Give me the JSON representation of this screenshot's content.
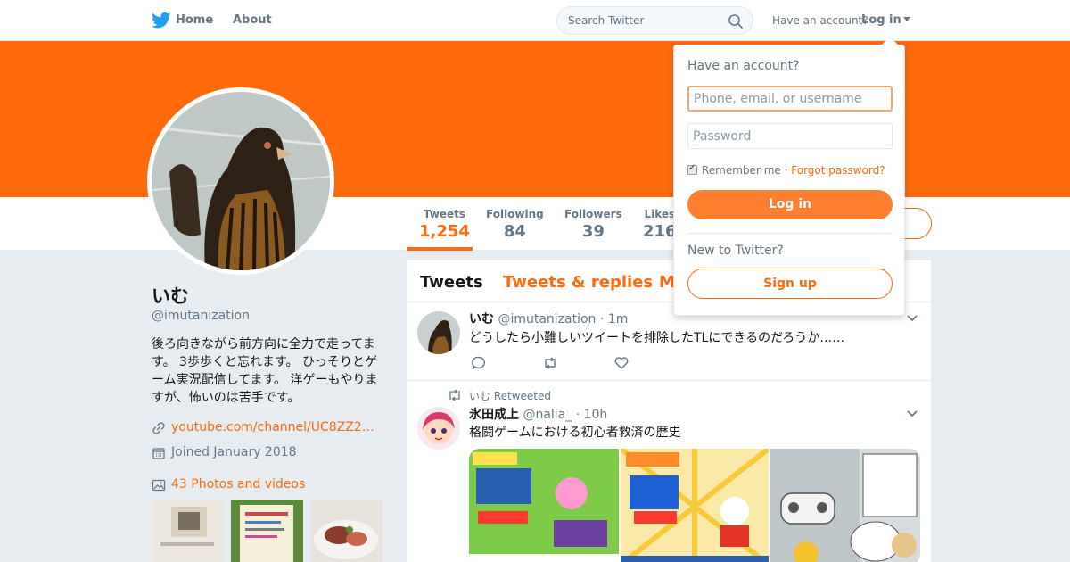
{
  "nav": {
    "home": "Home",
    "about": "About",
    "search_placeholder": "Search Twitter",
    "have_account": "Have an account?",
    "login": "Log in"
  },
  "profile": {
    "name": "いむ",
    "handle": "@imutanization",
    "bio": "後ろ向きながら前方向に全力で走ってます。 3歩歩くと忘れます。 ひっそりとゲーム実況配信してます。 洋ゲーもやりますが、怖いのは苦手です。",
    "link": "youtube.com/channel/UC8ZZ2…",
    "joined": "Joined January 2018",
    "photos": "43 Photos and videos"
  },
  "stats": [
    {
      "label": "Tweets",
      "value": "1,254"
    },
    {
      "label": "Following",
      "value": "84"
    },
    {
      "label": "Followers",
      "value": "39"
    },
    {
      "label": "Likes",
      "value": "216"
    }
  ],
  "timeline": {
    "tabs": [
      "Tweets",
      "Tweets & replies",
      "M"
    ],
    "tweets": [
      {
        "name": "いむ",
        "handle": "@imutanization",
        "time": "· 1m",
        "text": "どうしたら小難しいツイートを排除したTLにできるのだろうか……"
      },
      {
        "retweeted_by": "いむ Retweeted",
        "name": "氷田成上",
        "handle": "@nalia_",
        "time": "· 10h",
        "text": "格闘ゲームにおける初心者救済の歴史"
      }
    ]
  },
  "login_dropdown": {
    "title": "Have an account?",
    "user_placeholder": "Phone, email, or username",
    "password_placeholder": "Password",
    "remember": "Remember me",
    "dot": "·",
    "forgot": "Forgot password?",
    "login_button": "Log in",
    "new_to": "New to Twitter?",
    "signup_button": "Sign up"
  },
  "colors": {
    "accent": "#ff6a0d",
    "banner": "#ff6a0d",
    "brand_blue": "#1da1f2"
  }
}
